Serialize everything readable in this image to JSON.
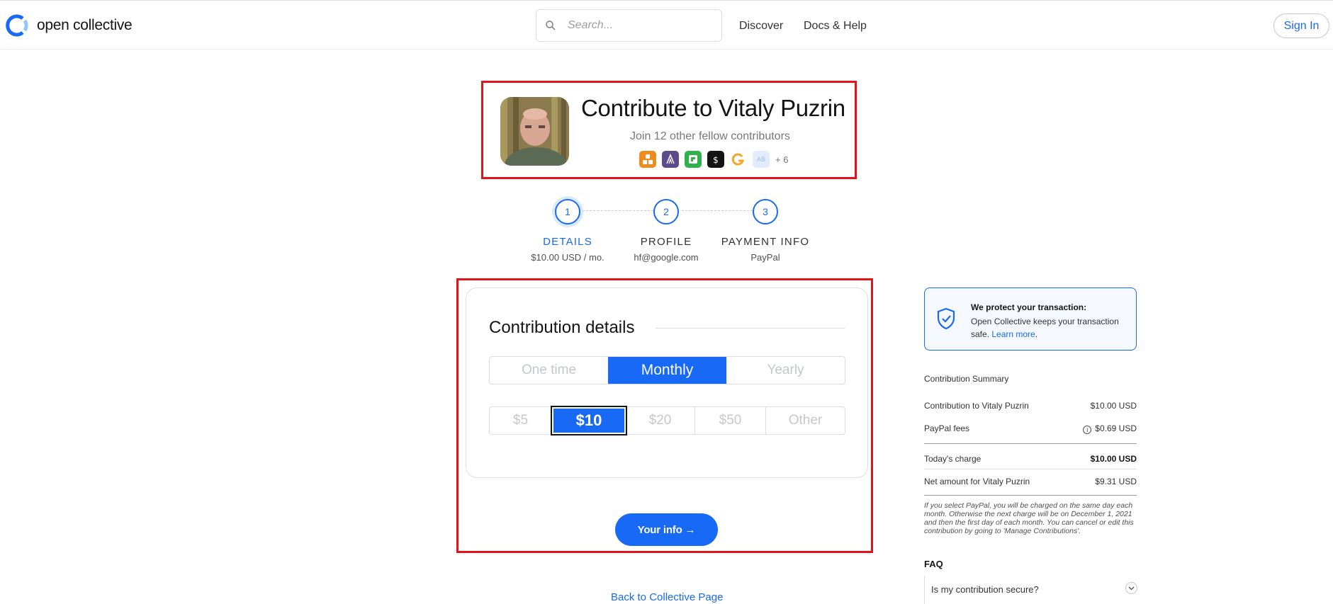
{
  "header": {
    "logo_text": "open collective",
    "search_placeholder": "Search...",
    "nav": [
      "Discover",
      "Docs & Help"
    ],
    "signin_label": "Sign In"
  },
  "collective": {
    "title": "Contribute to Vitaly Puzrin",
    "subtitle": "Join 12 other fellow contributors",
    "more_contributors": "+ 6",
    "contributor_initials": "AB"
  },
  "steps": [
    {
      "number": "1",
      "label": "DETAILS",
      "value": "$10.00 USD / mo.",
      "active": true
    },
    {
      "number": "2",
      "label": "PROFILE",
      "value": "hf@google.com",
      "active": false
    },
    {
      "number": "3",
      "label": "PAYMENT INFO",
      "value": "PayPal",
      "active": false
    }
  ],
  "contribution": {
    "title": "Contribution details",
    "intervals": [
      "One time",
      "Monthly",
      "Yearly"
    ],
    "selected_interval": "Monthly",
    "amounts": [
      "$5",
      "$10",
      "$20",
      "$50",
      "Other"
    ],
    "selected_amount": "$10",
    "next_button": "Your info →",
    "back_link": "Back to Collective Page"
  },
  "protect": {
    "title": "We protect your transaction:",
    "text": "Open Collective keeps your transaction safe.",
    "link": "Learn more",
    "suffix": "."
  },
  "summary": {
    "title": "Contribution Summary",
    "rows": [
      {
        "label": "Contribution to Vitaly Puzrin",
        "value": "$10.00 USD"
      },
      {
        "label": "PayPal fees",
        "value": "$0.69 USD"
      },
      {
        "label": "Today's charge",
        "value": "$10.00 USD"
      },
      {
        "label": "Net amount for Vitaly Puzrin",
        "value": "$9.31 USD"
      }
    ],
    "note": "If you select PayPal, you will be charged on the same day each month. Otherwise the next charge will be on December 1, 2021 and then the first day of each month. You can cancel or edit this contribution by going to 'Manage Contributions'."
  },
  "faq": {
    "title": "FAQ",
    "items": [
      "Is my contribution secure?"
    ]
  },
  "colors": {
    "primary": "#1869f5",
    "highlight_box": "#e2141b"
  }
}
